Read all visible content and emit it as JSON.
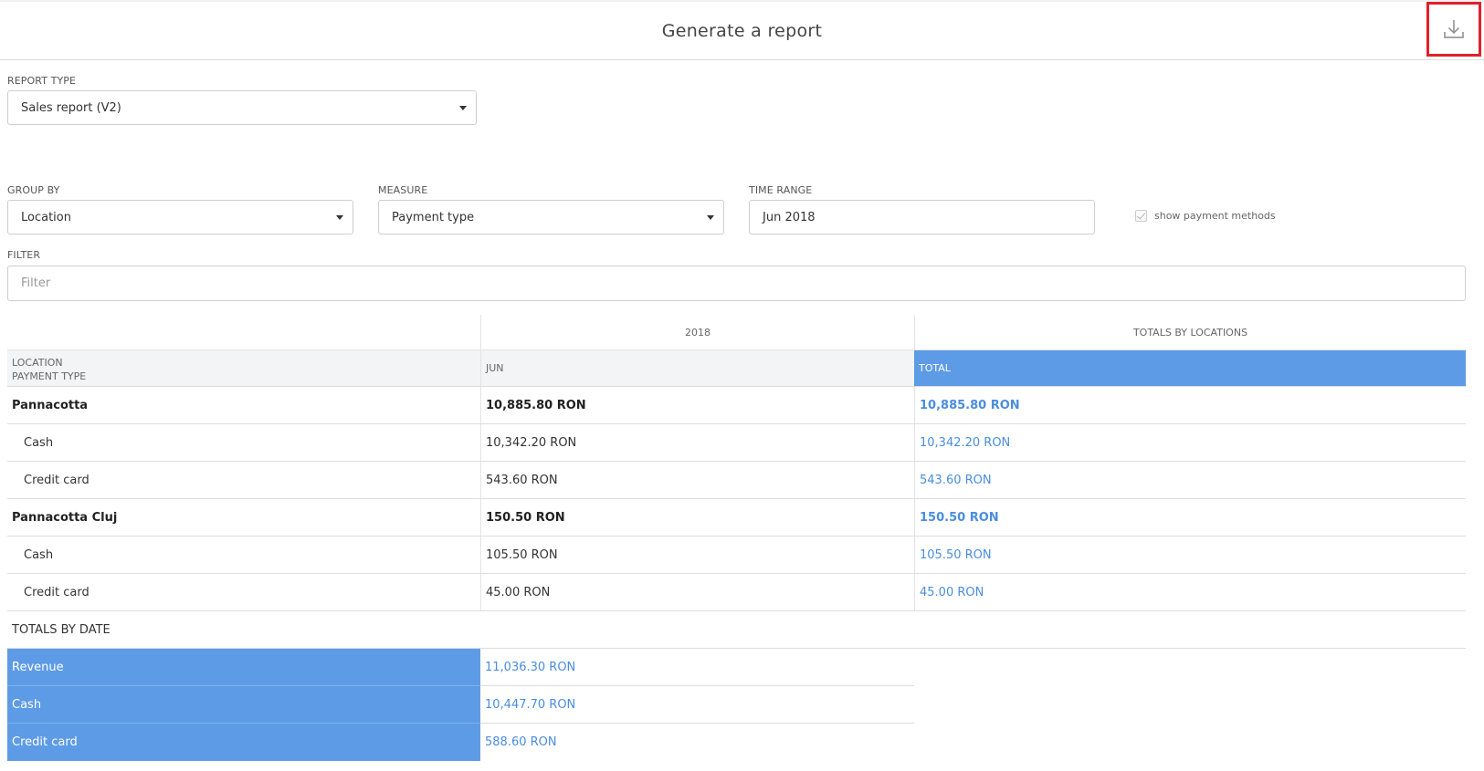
{
  "header": {
    "title": "Generate a report",
    "download_icon": "download-icon"
  },
  "report_type": {
    "label": "REPORT TYPE",
    "value": "Sales report (V2)"
  },
  "group_by": {
    "label": "GROUP BY",
    "value": "Location"
  },
  "measure": {
    "label": "MEASURE",
    "value": "Payment type"
  },
  "time_range": {
    "label": "TIME RANGE",
    "value": "Jun 2018"
  },
  "show_payment_methods": {
    "label": "show payment methods",
    "checked": true
  },
  "filter": {
    "label": "FILTER",
    "placeholder": "Filter"
  },
  "table": {
    "year_header": "2018",
    "totals_locations_header": "TOTALS BY LOCATIONS",
    "row_header_line1": "LOCATION",
    "row_header_line2": "PAYMENT TYPE",
    "month_header": "JUN",
    "total_header": "TOTAL",
    "rows": [
      {
        "label": "Pannacotta",
        "jun": "10,885.80 RON",
        "total": "10,885.80 RON"
      },
      {
        "label": "Cash",
        "jun": "10,342.20 RON",
        "total": "10,342.20 RON"
      },
      {
        "label": "Credit card",
        "jun": "543.60 RON",
        "total": "543.60 RON"
      },
      {
        "label": "Pannacotta Cluj",
        "jun": "150.50 RON",
        "total": "150.50 RON"
      },
      {
        "label": "Cash",
        "jun": "105.50 RON",
        "total": "105.50 RON"
      },
      {
        "label": "Credit card",
        "jun": "45.00 RON",
        "total": "45.00 RON"
      }
    ],
    "totals_by_date_label": "TOTALS BY DATE",
    "totals": [
      {
        "label": "Revenue",
        "value": "11,036.30 RON"
      },
      {
        "label": "Cash",
        "value": "10,447.70 RON"
      },
      {
        "label": "Credit card",
        "value": "588.60 RON"
      }
    ]
  },
  "colors": {
    "accent_blue": "#5e9be6",
    "link_blue": "#4a8de0",
    "highlight_red": "#e0202b"
  }
}
